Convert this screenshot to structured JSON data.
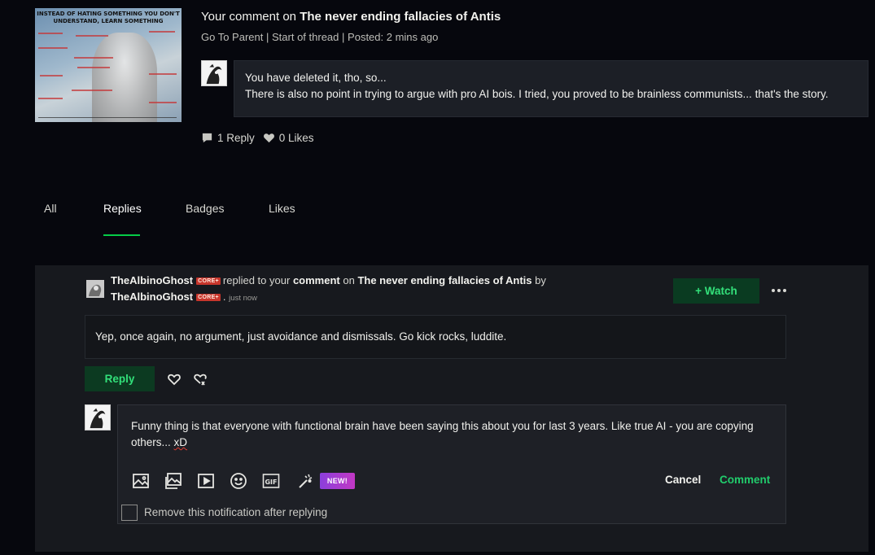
{
  "thumbnail": {
    "caption_line1": "INSTEAD OF HATING SOMETHING YOU DON'T",
    "caption_line2": "UNDERSTAND, LEARN SOMETHING"
  },
  "comment_header": {
    "prefix": "Your comment",
    "on_word": "on",
    "deviation_title": "The never ending fallacies of Antis"
  },
  "thread_links": {
    "go_to_parent": "Go To Parent",
    "start_of_thread": "Start of thread",
    "posted": "Posted: 2 mins ago",
    "separator": "|"
  },
  "quoted_comment": {
    "line1": "You have deleted it, tho, so...",
    "line2": "There is also no point in trying to argue with pro AI bois. I tried, you proved to be brainless communists... that's the story."
  },
  "stats": {
    "replies": "1 Reply",
    "likes": "0 Likes"
  },
  "tabs": [
    {
      "label": "All"
    },
    {
      "label": "Replies"
    },
    {
      "label": "Badges"
    },
    {
      "label": "Likes"
    }
  ],
  "notification": {
    "username": "TheAlbinoGhost",
    "badge": "CORE+",
    "text_replied": "replied to your",
    "text_comment": "comment",
    "text_on": "on",
    "deviation_title": "The never ending fallacies of Antis",
    "text_by": "by",
    "author": "TheAlbinoGhost",
    "dot": ".",
    "timestamp": "just now",
    "watch_label": "+ Watch"
  },
  "reply_message": "Yep, once again, no argument, just avoidance and dismissals. Go kick rocks, luddite.",
  "reply_button": "Reply",
  "compose": {
    "text_main": "Funny thing is that everyone with functional brain have been saying this about you for last 3 years. Like true AI - you are copying others... ",
    "text_misspelled": "xD",
    "new_badge": "NEW!",
    "cancel": "Cancel",
    "comment": "Comment",
    "remove_notification": "Remove this notification after replying"
  },
  "colors": {
    "accent_green": "#05cc47",
    "badge_red": "#c7362c",
    "background": "#06070d",
    "panel": "#17191e"
  },
  "icons": [
    "comment-icon",
    "heart-icon",
    "image-icon",
    "gallery-icon",
    "video-icon",
    "emoji-icon",
    "gif-icon",
    "magic-wand-icon",
    "like-outline-icon",
    "dislike-icon"
  ]
}
